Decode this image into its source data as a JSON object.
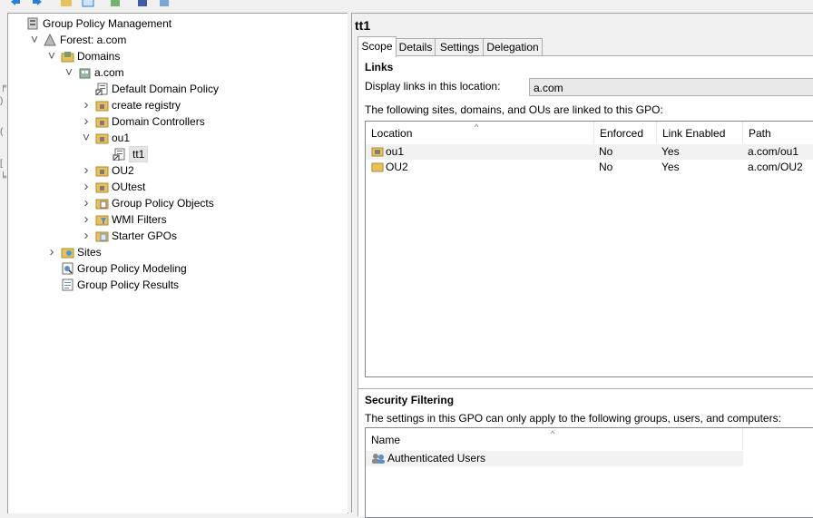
{
  "tree": {
    "items": [
      {
        "label": "Group Policy Management",
        "icon": "gpm-console-icon",
        "chevron": ""
      },
      {
        "label": "Forest: a.com",
        "icon": "forest-icon",
        "chevron": "expanded"
      },
      {
        "label": "Domains",
        "icon": "domains-icon",
        "chevron": "expanded"
      },
      {
        "label": "a.com",
        "icon": "domain-icon",
        "chevron": "expanded"
      },
      {
        "label": "Default Domain Policy",
        "icon": "gpo-link-icon",
        "chevron": ""
      },
      {
        "label": "create registry",
        "icon": "folder-icon",
        "chevron": "collapsed"
      },
      {
        "label": "Domain Controllers",
        "icon": "folder-icon",
        "chevron": "collapsed"
      },
      {
        "label": "ou1",
        "icon": "folder-icon",
        "chevron": "expanded"
      },
      {
        "label": "tt1",
        "icon": "gpo-link-icon",
        "chevron": "",
        "selected": true
      },
      {
        "label": "OU2",
        "icon": "folder-icon",
        "chevron": "collapsed"
      },
      {
        "label": "OUtest",
        "icon": "folder-icon",
        "chevron": "collapsed"
      },
      {
        "label": "Group Policy Objects",
        "icon": "gpo-folder-icon",
        "chevron": "collapsed"
      },
      {
        "label": "WMI Filters",
        "icon": "wmi-filter-icon",
        "chevron": "collapsed"
      },
      {
        "label": "Starter GPOs",
        "icon": "starter-gpo-icon",
        "chevron": "collapsed"
      },
      {
        "label": "Sites",
        "icon": "sites-icon",
        "chevron": "collapsed"
      },
      {
        "label": "Group Policy Modeling",
        "icon": "modeling-icon",
        "chevron": ""
      },
      {
        "label": "Group Policy Results",
        "icon": "results-icon",
        "chevron": ""
      }
    ]
  },
  "details": {
    "title": "tt1",
    "tabs": [
      {
        "label": "Scope",
        "active": true
      },
      {
        "label": "Details"
      },
      {
        "label": "Settings"
      },
      {
        "label": "Delegation"
      }
    ],
    "links": {
      "heading": "Links",
      "display_label": "Display links in this location:",
      "display_value": "a.com",
      "description": "The following sites, domains, and OUs are linked to this GPO:",
      "columns": [
        "Location",
        "Enforced",
        "Link Enabled",
        "Path"
      ],
      "rows": [
        {
          "location": "ou1",
          "enforced": "No",
          "enabled": "Yes",
          "path": "a.com/ou1"
        },
        {
          "location": "OU2",
          "enforced": "No",
          "enabled": "Yes",
          "path": "a.com/OU2"
        }
      ]
    },
    "security": {
      "heading": "Security Filtering",
      "description": "The settings in this GPO can only apply to the following groups, users, and computers:",
      "columns": [
        "Name"
      ],
      "rows": [
        {
          "name": "Authenticated Users"
        }
      ]
    }
  },
  "colors": {
    "folder": "#e8c15a",
    "selection": "#e5e5e5",
    "border": "#a0a0a0"
  }
}
